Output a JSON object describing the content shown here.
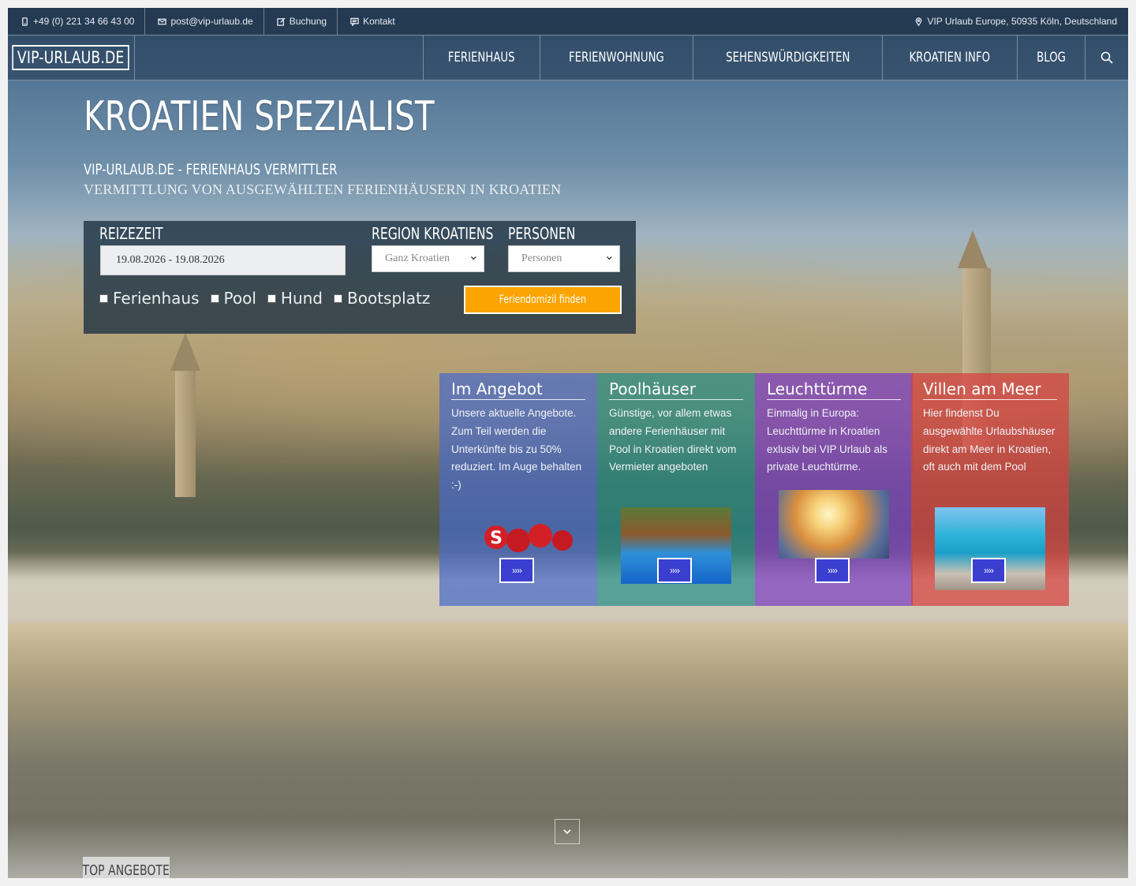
{
  "topbar": {
    "phone": "+49 (0) 221 34 66 43 00",
    "email": "post@vip-urlaub.de",
    "booking": "Buchung",
    "contact": "Kontakt",
    "address": "VIP Urlaub Europe, 50935 Köln, Deutschland"
  },
  "nav": {
    "logo": "VIP-URLAUB.DE",
    "items": [
      "Ferienhaus",
      "Ferienwohnung",
      "Sehenswürdigkeiten",
      "Kroatien Info",
      "Blog"
    ],
    "search_icon": "search-icon"
  },
  "hero": {
    "title": "KROATIEN SPEZIALIST",
    "subtitle": "VIP-URLAUB.DE - FERIENHAUS VERMITTLER",
    "tagline": "VERMITTLUNG VON AUSGEWÄHLTEN FERIENHÄUSERN IN KROATIEN"
  },
  "search": {
    "travel_label": "REIZEZEIT",
    "date_value": "19.08.2026 - 19.08.2026",
    "region_label": "REGION KROATIENS",
    "region_value": "Ganz Kroatien",
    "persons_label": "PERSONEN",
    "persons_value": "Personen",
    "checkboxes": [
      "Ferienhaus",
      "Pool",
      "Hund",
      "Bootsplatz"
    ],
    "submit_label": "Feriendomizil finden"
  },
  "cards": [
    {
      "title": "Im Angebot",
      "text": "Unsere aktuelle Angebote. Zum Teil werden die Unterkünfte bis zu 50% reduziert. Im Auge behalten :-)",
      "image": "SALE",
      "button": "››››",
      "color": "#4a6bc8"
    },
    {
      "title": "Poolhäuser",
      "text": "Günstige, vor allem etwas andere Ferienhäuser mit Pool in Kroatien direkt vom Vermieter angeboten",
      "button": "››››",
      "color": "#1f8f8a"
    },
    {
      "title": "Leuchttürme",
      "text": "Einmalig in Europa: Leuchttürme in Kroatien exlusiv bei VIP Urlaub als private Leuchtürme.",
      "button": "››››",
      "color": "#7b3fc2"
    },
    {
      "title": "Villen am Meer",
      "text": "Hier findenst Du ausgewählte Urlaubshäuser direkt am Meer in Kroatien, oft auch mit dem Pool",
      "button": "››››",
      "color": "#d7403f"
    }
  ],
  "footer": {
    "top_offers": "TOP ANGEBOTE"
  },
  "colors": {
    "accent": "#fca402",
    "nav_bg": "#203650",
    "button_blue": "#3a3fd0"
  }
}
